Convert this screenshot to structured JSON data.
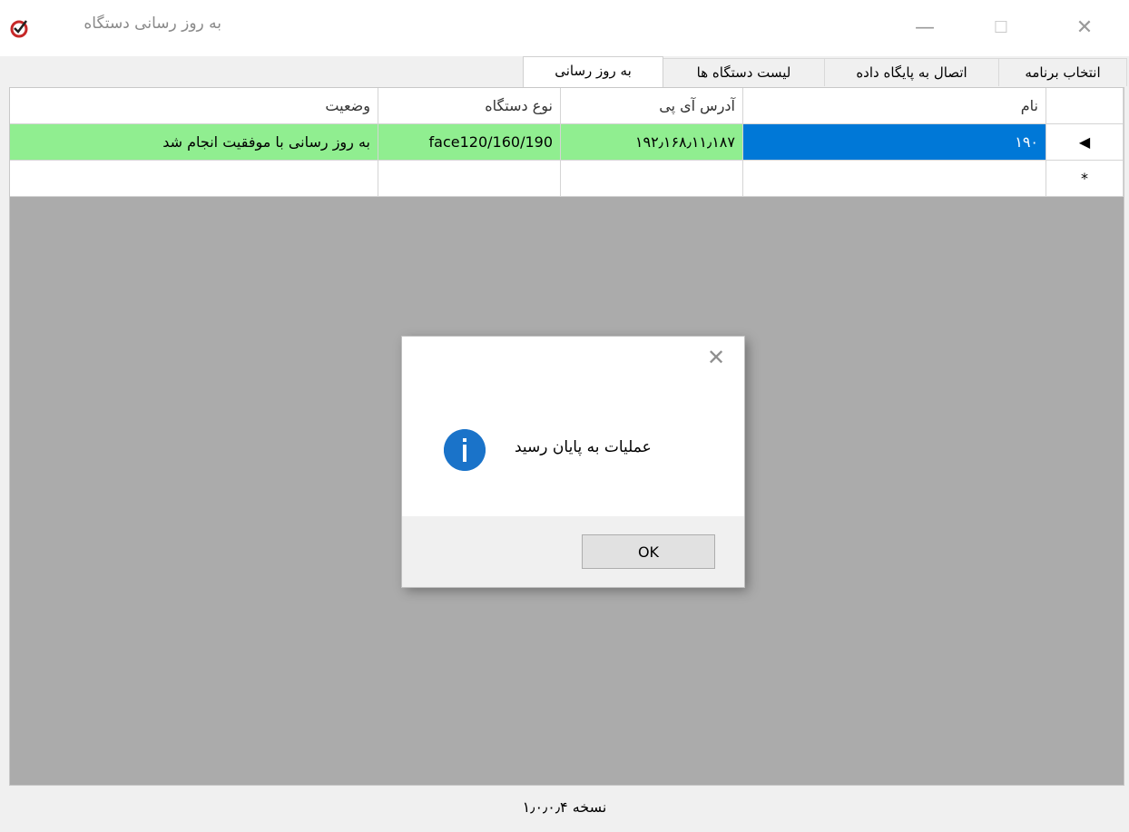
{
  "window": {
    "title": "به روز رسانی دستگاه",
    "minimize_glyph": "—",
    "maximize_glyph": "☐",
    "close_glyph": "✕"
  },
  "tabs": [
    {
      "label": "انتخاب برنامه"
    },
    {
      "label": "اتصال به پایگاه داده"
    },
    {
      "label": "لیست دستگاه ها"
    },
    {
      "label": "به روز رسانی"
    }
  ],
  "active_tab_index": 3,
  "grid": {
    "columns": [
      "نام",
      "آدرس آی پی",
      "نوع دستگاه",
      "وضعیت"
    ],
    "rows": [
      {
        "name": "۱۹۰",
        "ip": "۱۹۲٫۱۶۸٫۱۱٫۱۸۷",
        "device_type": "face120/160/190",
        "status": "به روز رسانی با موفقیت انجام شد",
        "row_marker": "◀"
      },
      {
        "name": "",
        "ip": "",
        "device_type": "",
        "status": "",
        "row_marker": "*"
      }
    ]
  },
  "status_bar": {
    "version": "نسخه ۱٫۰٫۰٫۴"
  },
  "dialog": {
    "message": "عملیات به پایان رسید",
    "ok_label": "OK",
    "close_glyph": "✕",
    "icon": "info-icon"
  },
  "colors": {
    "status_ok": "#90ee90",
    "selection": "#0078d7",
    "info_blue": "#1a73c9"
  }
}
